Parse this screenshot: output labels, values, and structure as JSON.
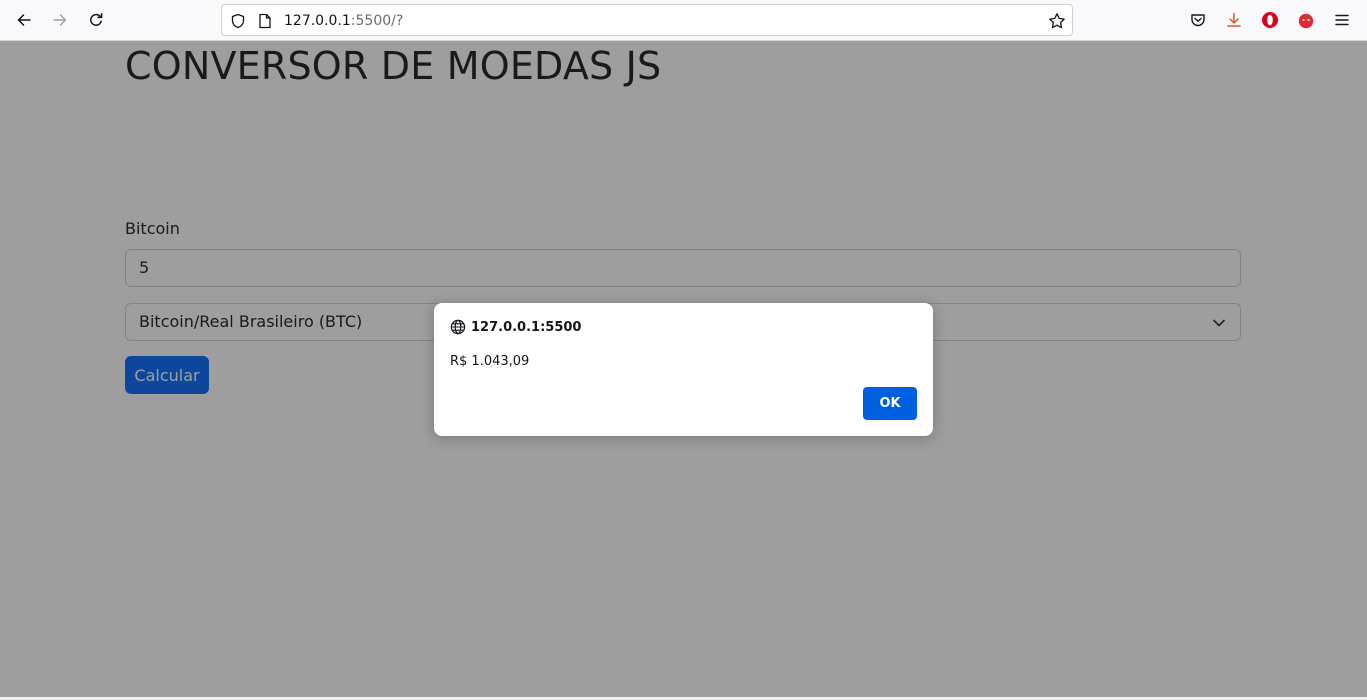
{
  "browser": {
    "url_host": "127.0.0.1",
    "url_rest": ":5500/?"
  },
  "page": {
    "title": "CONVERSOR DE MOEDAS JS",
    "amount_label": "Bitcoin",
    "amount_value": "5",
    "currency_selected": "Bitcoin/Real Brasileiro (BTC)",
    "calculate_label": "Calcular"
  },
  "dialog": {
    "origin": "127.0.0.1:5500",
    "message": "R$ 1.043,09",
    "ok_label": "OK"
  },
  "colors": {
    "primary": "#0d6efd",
    "dialog_button": "#0061e0",
    "title_text": "#212529",
    "overlay": "rgba(12,12,13,0.40)"
  },
  "icons": {
    "back": "arrow-left-icon",
    "forward": "arrow-right-icon",
    "reload": "reload-icon",
    "tracking_protection": "shield-icon",
    "page_info": "page-icon",
    "bookmark": "star-icon",
    "pocket": "pocket-icon",
    "downloads": "download-icon",
    "extension_1": "opera-extension-icon",
    "extension_2": "tomato-extension-icon",
    "menu": "hamburger-menu-icon",
    "dialog_origin": "globe-icon",
    "select_chevron": "chevron-down-icon"
  }
}
